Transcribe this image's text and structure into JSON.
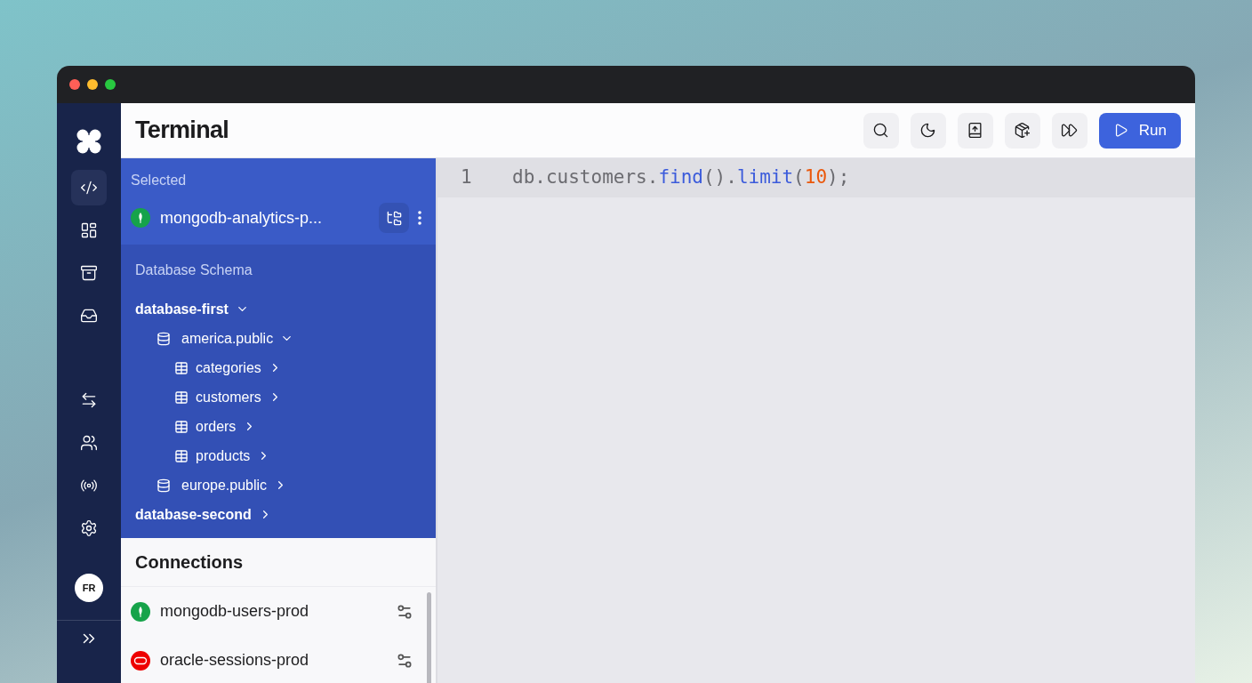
{
  "window": {
    "title": "Terminal"
  },
  "nav": {
    "top": [
      {
        "selected": true
      },
      {
        "selected": false
      },
      {
        "selected": false
      },
      {
        "selected": false
      }
    ],
    "bottom": [
      {
        "selected": false
      },
      {
        "selected": false
      },
      {
        "selected": false
      },
      {
        "selected": false
      }
    ],
    "avatar": "FR"
  },
  "toolbar": {
    "run_button": "Run"
  },
  "selected_connection": {
    "heading": "Selected",
    "name": "mongodb-analytics-p...",
    "kind": "mongodb"
  },
  "schema": {
    "heading": "Database Schema",
    "tree": [
      {
        "label": "database-first",
        "kind": "database",
        "expanded": true,
        "children": [
          {
            "label": "america.public",
            "kind": "schema",
            "expanded": true,
            "children": [
              {
                "label": "categories",
                "kind": "table",
                "expanded": false
              },
              {
                "label": "customers",
                "kind": "table",
                "expanded": false
              },
              {
                "label": "orders",
                "kind": "table",
                "expanded": false
              },
              {
                "label": "products",
                "kind": "table",
                "expanded": false
              }
            ]
          },
          {
            "label": "europe.public",
            "kind": "schema",
            "expanded": false
          }
        ]
      },
      {
        "label": "database-second",
        "kind": "database",
        "expanded": false
      }
    ]
  },
  "connections": {
    "heading": "Connections",
    "items": [
      {
        "name": "mongodb-users-prod",
        "kind": "mongodb"
      },
      {
        "name": "oracle-sessions-prod",
        "kind": "oracle"
      }
    ]
  },
  "editor": {
    "lines": [
      {
        "number": "1",
        "tokens": [
          {
            "text": "db.customers.",
            "kind": "plain"
          },
          {
            "text": "find",
            "kind": "method"
          },
          {
            "text": "().",
            "kind": "plain"
          },
          {
            "text": "limit",
            "kind": "method"
          },
          {
            "text": "(",
            "kind": "plain"
          },
          {
            "text": "10",
            "kind": "number"
          },
          {
            "text": ");",
            "kind": "plain"
          }
        ]
      }
    ]
  }
}
